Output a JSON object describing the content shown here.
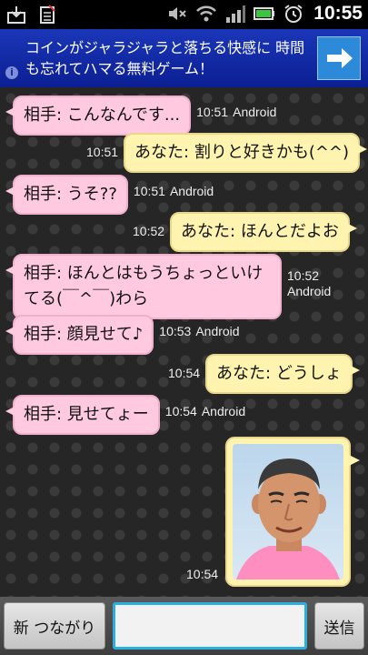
{
  "status_bar": {
    "time": "10:55",
    "icons": [
      "download-icon",
      "sim-card-icon",
      "mute-icon",
      "wifi-icon",
      "signal-icon",
      "battery-icon",
      "alarm-icon"
    ]
  },
  "ad": {
    "text": "コインがジャラジャラと落ちる快感に 時間も忘れてハマる無料ゲーム！",
    "info": "i"
  },
  "messages": [
    {
      "from": "them",
      "text": "相手: こんなんです...",
      "time": "10:51",
      "device": "Android"
    },
    {
      "from": "me",
      "text": "あなた: 割りと好きかも(^^)",
      "time": "10:51"
    },
    {
      "from": "them",
      "text": "相手: うそ??",
      "time": "10:51",
      "device": "Android"
    },
    {
      "from": "me",
      "text": "あなた: ほんとだよお",
      "time": "10:52"
    },
    {
      "from": "them",
      "text_line1": "相手: ほんとはもうちょっといけ",
      "text_line2": "てる(￣^￣)わら",
      "time": "10:52",
      "device": "Android"
    },
    {
      "from": "them",
      "text": "相手: 顔見せて♪",
      "time": "10:53",
      "device": "Android"
    },
    {
      "from": "me",
      "text": "あなた: どうしょ",
      "time": "10:54"
    },
    {
      "from": "them",
      "text": "相手: 見せてょー",
      "time": "10:54",
      "device": "Android"
    },
    {
      "from": "me",
      "type": "photo",
      "time": "10:54"
    }
  ],
  "bottom_bar": {
    "new_connection": "新 つながり",
    "message_input_value": "",
    "send": "送信"
  },
  "colors": {
    "their_bubble": "#ffc9df",
    "my_bubble": "#fff3b0",
    "ad_background": "#1a36b8",
    "input_border": "#2ab0e0"
  }
}
